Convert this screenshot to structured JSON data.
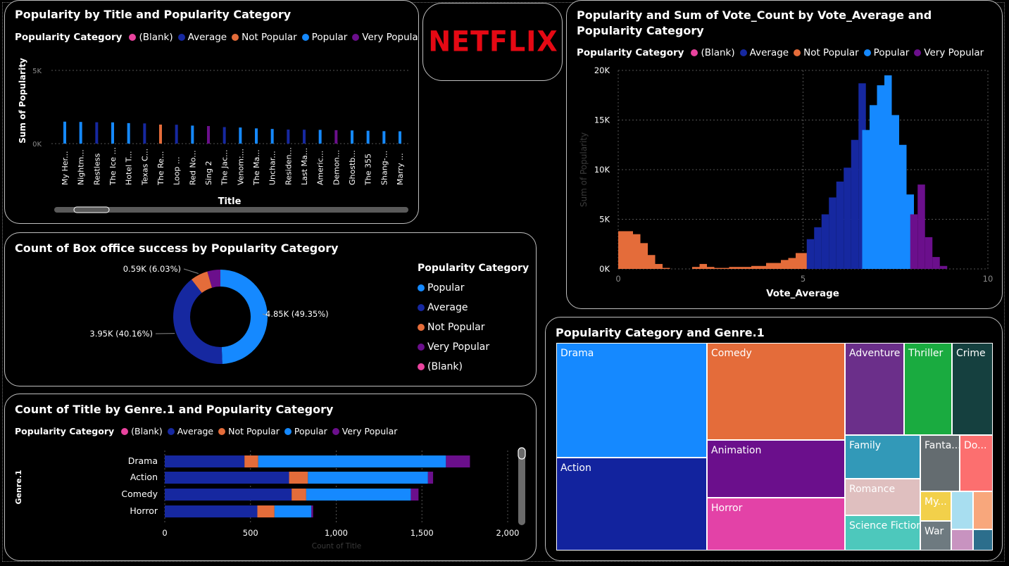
{
  "colors": {
    "blank": "#e9439e",
    "average": "#1628a0",
    "not_popular": "#e46c3a",
    "popular": "#1589ff",
    "very_popular": "#6b0f8c"
  },
  "legend_categories": [
    {
      "key": "blank",
      "label": "(Blank)"
    },
    {
      "key": "average",
      "label": "Average"
    },
    {
      "key": "not_popular",
      "label": "Not Popular"
    },
    {
      "key": "popular",
      "label": "Popular"
    },
    {
      "key": "very_popular",
      "label": "Very Popular"
    }
  ],
  "legend_title": "Popularity Category",
  "logo": {
    "text": "NETFLIX"
  },
  "chart1": {
    "title": "Popularity by Title and Popularity Category",
    "chart_data": {
      "type": "bar",
      "title": "Popularity by Title and Popularity Category",
      "xlabel": "Title",
      "ylabel": "Sum of Popularity",
      "yticks": [
        "5K",
        "0K"
      ],
      "ylim": [
        0,
        5000
      ],
      "categories": [
        "My Her...",
        "Nightm...",
        "Restless",
        "The Ice ...",
        "Hotel T...",
        "Texas C...",
        "The Re...",
        "Loop ...",
        "Red No...",
        "Sing 2",
        "The Jac...",
        "Venom:...",
        "The Ma...",
        "Unchar...",
        "Residen...",
        "Last Ma...",
        "Americ...",
        "Demon...",
        "Ghostb...",
        "The 355",
        "Shang-...",
        "Marry ..."
      ],
      "values": [
        1500,
        1480,
        1460,
        1450,
        1400,
        1380,
        1300,
        1290,
        1230,
        1200,
        1130,
        1100,
        1040,
        1000,
        960,
        950,
        940,
        920,
        900,
        880,
        850,
        840
      ],
      "series_keys": [
        "popular",
        "popular",
        "average",
        "popular",
        "popular",
        "average",
        "not_popular",
        "average",
        "popular",
        "very_popular",
        "average",
        "popular",
        "popular",
        "popular",
        "average",
        "average",
        "popular",
        "very_popular",
        "popular",
        "popular",
        "popular",
        "popular"
      ]
    }
  },
  "chart2": {
    "title": "Popularity and Sum of Vote_Count by Vote_Average and Popularity Category",
    "chart_data": {
      "type": "bar",
      "title": "Popularity and Sum of Vote_Count by Vote_Average and Popularity Category",
      "xlabel": "Vote_Average",
      "ylabel": "Sum of Popularity",
      "xlim": [
        0,
        10
      ],
      "ylim": [
        0,
        20000
      ],
      "xticks": [
        "0",
        "5",
        "10"
      ],
      "yticks": [
        "0K",
        "5K",
        "10K",
        "15K",
        "20K"
      ],
      "series": [
        {
          "name": "Not Popular",
          "key": "not_popular",
          "x": [
            0.0,
            0.2,
            0.4,
            0.6,
            0.8,
            1.0,
            1.2,
            1.4,
            1.6,
            1.8,
            2.0,
            2.2,
            2.4,
            2.6,
            2.8,
            3.0,
            3.2,
            3.4,
            3.6,
            3.8,
            4.0,
            4.2,
            4.4,
            4.6,
            4.8,
            5.0
          ],
          "values": [
            3800,
            3800,
            3500,
            2600,
            1400,
            500,
            100,
            0,
            0,
            0,
            200,
            500,
            200,
            100,
            100,
            200,
            200,
            200,
            300,
            300,
            600,
            600,
            900,
            1100,
            1600,
            1600
          ]
        },
        {
          "name": "Average",
          "key": "average",
          "x": [
            5.1,
            5.3,
            5.5,
            5.7,
            5.9,
            6.1,
            6.3,
            6.5
          ],
          "values": [
            3000,
            4200,
            5500,
            7200,
            8800,
            10200,
            13000,
            18700
          ]
        },
        {
          "name": "Popular",
          "key": "popular",
          "x": [
            6.6,
            6.8,
            7.0,
            7.2,
            7.4,
            7.6,
            7.8
          ],
          "values": [
            14000,
            16500,
            18500,
            19500,
            15500,
            12500,
            7500
          ]
        },
        {
          "name": "Very Popular",
          "key": "very_popular",
          "x": [
            7.9,
            8.1,
            8.3,
            8.5,
            8.7
          ],
          "values": [
            5500,
            8500,
            3200,
            1200,
            300
          ]
        }
      ]
    }
  },
  "chart3": {
    "title": "Count of Box office success by Popularity Category",
    "chart_data": {
      "type": "pie",
      "title": "Count of Box office success by Popularity Category",
      "slices": [
        {
          "name": "Popular",
          "key": "popular",
          "value": 4850,
          "label": "4.85K (49.35%)"
        },
        {
          "name": "Average",
          "key": "average",
          "value": 3950,
          "label": "3.95K (40.16%)"
        },
        {
          "name": "Not Popular",
          "key": "not_popular",
          "value": 590,
          "label": "0.59K (6.03%)"
        },
        {
          "name": "Very Popular",
          "key": "very_popular",
          "value": 440,
          "label": ""
        },
        {
          "name": "(Blank)",
          "key": "blank",
          "value": 0,
          "label": ""
        }
      ]
    },
    "legend_items": [
      {
        "key": "popular",
        "label": "Popular"
      },
      {
        "key": "average",
        "label": "Average"
      },
      {
        "key": "not_popular",
        "label": "Not Popular"
      },
      {
        "key": "very_popular",
        "label": "Very Popular"
      },
      {
        "key": "blank",
        "label": "(Blank)"
      }
    ]
  },
  "chart4": {
    "title": "Count of Title by Genre.1 and Popularity Category",
    "chart_data": {
      "type": "bar",
      "orientation": "horizontal",
      "stacked": true,
      "title": "Count of Title by Genre.1 and Popularity Category",
      "xlabel": "Count of Title",
      "ylabel": "Genre.1",
      "xlim": [
        0,
        2000
      ],
      "xticks": [
        "0",
        "500",
        "1,000",
        "1,500",
        "2,000"
      ],
      "categories": [
        "Drama",
        "Action",
        "Comedy",
        "Horror"
      ],
      "series": [
        {
          "name": "Average",
          "key": "average",
          "values": [
            465,
            725,
            740,
            540
          ]
        },
        {
          "name": "Not Popular",
          "key": "not_popular",
          "values": [
            80,
            110,
            85,
            100
          ]
        },
        {
          "name": "Popular",
          "key": "popular",
          "values": [
            1095,
            700,
            610,
            215
          ]
        },
        {
          "name": "Very Popular",
          "key": "very_popular",
          "values": [
            140,
            30,
            45,
            10
          ]
        },
        {
          "name": "(Blank)",
          "key": "blank",
          "values": [
            0,
            0,
            0,
            0
          ]
        }
      ]
    }
  },
  "chart5": {
    "title": "Popularity Category and Genre.1",
    "chart_data": {
      "type": "treemap",
      "title": "Popularity Category and Genre.1",
      "items": [
        {
          "label": "Drama",
          "color": "#1589ff"
        },
        {
          "label": "Action",
          "color": "#12239e"
        },
        {
          "label": "Comedy",
          "color": "#e46c3a"
        },
        {
          "label": "Animation",
          "color": "#6b0f8c"
        },
        {
          "label": "Horror",
          "color": "#e342a7"
        },
        {
          "label": "Adventure",
          "color": "#6b2f8a"
        },
        {
          "label": "Thriller",
          "color": "#1aab40"
        },
        {
          "label": "Crime",
          "color": "#15403f"
        },
        {
          "label": "Family",
          "color": "#3299b8"
        },
        {
          "label": "Fanta...",
          "color": "#646c70"
        },
        {
          "label": "Do...",
          "color": "#fc6f6f"
        },
        {
          "label": "Romance",
          "color": "#dfbfbf"
        },
        {
          "label": "My...",
          "color": "#f2d04a"
        },
        {
          "label": "Science Fiction",
          "color": "#4dc8bc"
        },
        {
          "label": "War",
          "color": "#6e7a80"
        },
        {
          "label": "",
          "color": "#a8def0"
        },
        {
          "label": "",
          "color": "#f8a77c"
        },
        {
          "label": "",
          "color": "#c893c0"
        },
        {
          "label": "",
          "color": "#2c6e8c"
        }
      ]
    }
  }
}
